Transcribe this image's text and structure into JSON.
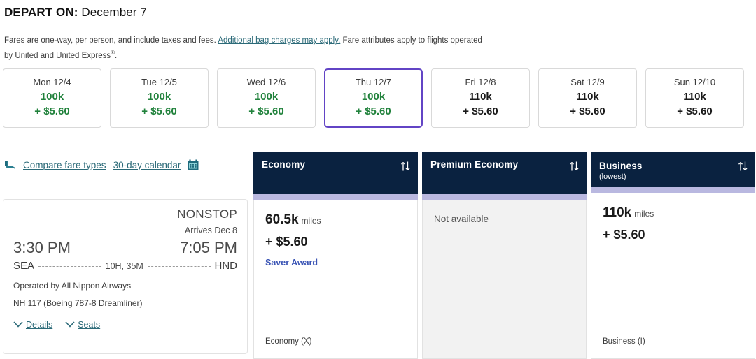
{
  "header": {
    "label": "DEPART ON:",
    "date": "December 7",
    "note_before": "Fares are one-way, per person, and include taxes and fees. ",
    "note_link": "Additional bag charges may apply.",
    "note_after": " Fare attributes apply to flights operated by United and United Express",
    "note_sup": "®",
    "note_end": "."
  },
  "date_strip": [
    {
      "day": "Mon 12/4",
      "miles": "100k",
      "cash": "+ $5.60",
      "selected": false,
      "highlight": true
    },
    {
      "day": "Tue 12/5",
      "miles": "100k",
      "cash": "+ $5.60",
      "selected": false,
      "highlight": true
    },
    {
      "day": "Wed 12/6",
      "miles": "100k",
      "cash": "+ $5.60",
      "selected": false,
      "highlight": true
    },
    {
      "day": "Thu 12/7",
      "miles": "100k",
      "cash": "+ $5.60",
      "selected": true,
      "highlight": true
    },
    {
      "day": "Fri 12/8",
      "miles": "110k",
      "cash": "+ $5.60",
      "selected": false,
      "highlight": false
    },
    {
      "day": "Sat 12/9",
      "miles": "110k",
      "cash": "+ $5.60",
      "selected": false,
      "highlight": false
    },
    {
      "day": "Sun 12/10",
      "miles": "110k",
      "cash": "+ $5.60",
      "selected": false,
      "highlight": false
    }
  ],
  "links_row": {
    "compare": "Compare fare types",
    "calendar": "30-day calendar",
    "seat_icon": "seat-icon",
    "calendar_icon": "calendar-icon"
  },
  "flight": {
    "nonstop": "NONSTOP",
    "arrives": "Arrives Dec 8",
    "depart_time": "3:30 PM",
    "arrive_time": "7:05 PM",
    "origin": "SEA",
    "destination": "HND",
    "duration": "10H, 35M",
    "operated": "Operated by All Nippon Airways",
    "equipment": "NH 117 (Boeing 787-8 Dreamliner)",
    "details_link": "Details",
    "seats_link": "Seats"
  },
  "fares": [
    {
      "title": "Economy",
      "subtitle": null,
      "available": true,
      "miles": "60.5k",
      "unit": "miles",
      "cash": "+ $5.60",
      "award_label": "Saver Award",
      "footer": "Economy (X)",
      "sort_icon": "sort-updown-icon"
    },
    {
      "title": "Premium Economy",
      "subtitle": null,
      "available": false,
      "unavailable_text": "Not available",
      "footer": "",
      "sort_icon": "sort-updown-icon"
    },
    {
      "title": "Business",
      "subtitle": "(lowest)",
      "available": true,
      "miles": "110k",
      "unit": "miles",
      "cash": "+ $5.60",
      "award_label": null,
      "footer": "Business (I)",
      "sort_icon": "sort-updown-icon"
    }
  ],
  "colors": {
    "navy": "#0a2240",
    "lavender": "#b9b8e0",
    "green": "#21823c",
    "teal_link": "#2b6a78",
    "selected_border": "#6244c5",
    "saver_blue": "#3b55b5"
  }
}
